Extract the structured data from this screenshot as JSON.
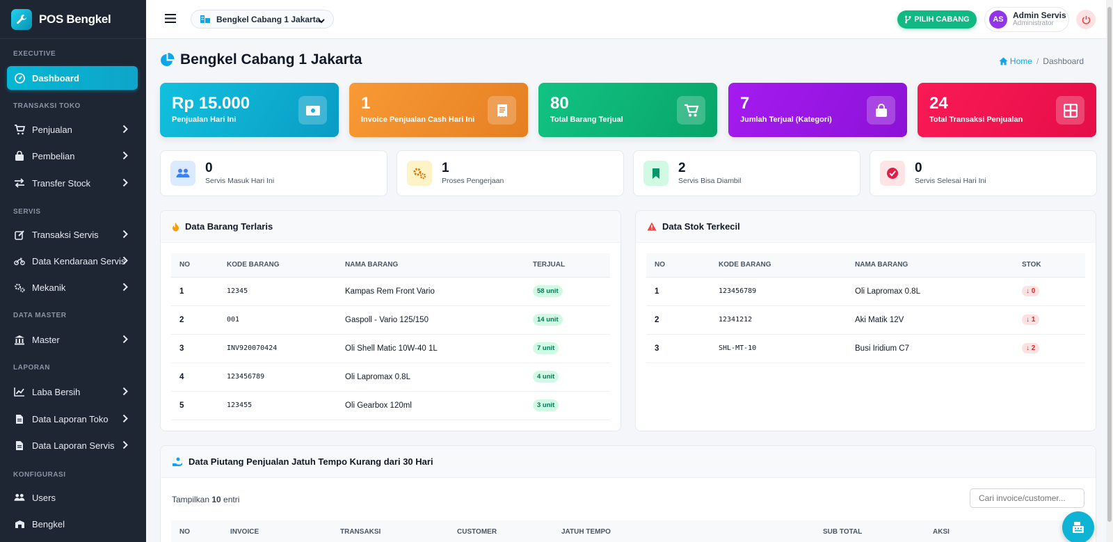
{
  "app": {
    "name": "POS Bengkel"
  },
  "sidebar": {
    "sections": [
      "EXECUTIVE",
      "TRANSAKSI TOKO",
      "SERVIS",
      "DATA MASTER",
      "LAPORAN",
      "KONFIGURASI"
    ],
    "items": [
      {
        "label": "Dashboard",
        "icon": "dashboard-icon"
      },
      {
        "label": "Penjualan",
        "icon": "cart-icon"
      },
      {
        "label": "Pembelian",
        "icon": "bag-icon"
      },
      {
        "label": "Transfer Stock",
        "icon": "transfer-icon"
      },
      {
        "label": "Transaksi Servis",
        "icon": "edit-icon"
      },
      {
        "label": "Data Kendaraan Servis",
        "icon": "motorcycle-icon"
      },
      {
        "label": "Mekanik",
        "icon": "gears-icon"
      },
      {
        "label": "Master",
        "icon": "bank-icon"
      },
      {
        "label": "Laba Bersih",
        "icon": "chart-line-icon"
      },
      {
        "label": "Data Laporan Toko",
        "icon": "file-icon"
      },
      {
        "label": "Data Laporan Servis",
        "icon": "file-icon"
      },
      {
        "label": "Users",
        "icon": "users-icon"
      },
      {
        "label": "Bengkel",
        "icon": "building-icon"
      }
    ]
  },
  "topbar": {
    "branch": "Bengkel Cabang 1 Jakarta",
    "pilih_cabang": "PILIH CABANG",
    "user_initials": "AS",
    "user_name": "Admin Servis",
    "user_role": "Administrator"
  },
  "page": {
    "title": "Bengkel Cabang 1 Jakarta",
    "breadcrumb_home": "Home",
    "breadcrumb_sep": "/",
    "breadcrumb_current": "Dashboard"
  },
  "stats": [
    {
      "value": "Rp 15.000",
      "label": "Penjualan Hari Ini",
      "color": "#0fb3d6",
      "icon": "money-icon"
    },
    {
      "value": "1",
      "label": "Invoice Penjualan Cash Hari Ini",
      "color": "#f3902f",
      "icon": "receipt-icon"
    },
    {
      "value": "80",
      "label": "Total Barang Terjual",
      "color": "#10b577",
      "icon": "cart-icon"
    },
    {
      "value": "7",
      "label": "Jumlah Terjual (Kategori)",
      "color": "#9b16e8",
      "icon": "shopping-bag-icon"
    },
    {
      "value": "24",
      "label": "Total Transaksi Penjualan",
      "color": "#f2134f",
      "icon": "grid-icon"
    }
  ],
  "service_stats": [
    {
      "value": "0",
      "label": "Servis Masuk Hari Ini",
      "icon": "users-icon",
      "color": "#3b82f6",
      "bg": "#dbeafe"
    },
    {
      "value": "1",
      "label": "Proses Pengerjaan",
      "icon": "gears-icon",
      "color": "#d97706",
      "bg": "#fef3c7"
    },
    {
      "value": "2",
      "label": "Servis Bisa Diambil",
      "icon": "bookmark-icon",
      "color": "#059669",
      "bg": "#d1fae5"
    },
    {
      "value": "0",
      "label": "Servis Selesai Hari Ini",
      "icon": "check-circle-icon",
      "color": "#e11d48",
      "bg": "#ffe4e6"
    }
  ],
  "terlaris": {
    "title": "Data Barang Terlaris",
    "headers": [
      "NO",
      "KODE BARANG",
      "NAMA BARANG",
      "TERJUAL"
    ],
    "rows": [
      [
        "1",
        "12345",
        "Kampas Rem Front Vario",
        "58 unit"
      ],
      [
        "2",
        "001",
        "Gaspoll - Vario 125/150",
        "14 unit"
      ],
      [
        "3",
        "INV920070424",
        "Oli Shell Matic 10W-40 1L",
        "7 unit"
      ],
      [
        "4",
        "123456789",
        "Oli Lapromax 0.8L",
        "4 unit"
      ],
      [
        "5",
        "123455",
        "Oli Gearbox 120ml",
        "3 unit"
      ]
    ]
  },
  "stok": {
    "title": "Data Stok Terkecil",
    "headers": [
      "NO",
      "KODE BARANG",
      "NAMA BARANG",
      "STOK"
    ],
    "rows": [
      [
        "1",
        "123456789",
        "Oli Lapromax 0.8L",
        "0"
      ],
      [
        "2",
        "12341212",
        "Aki Matik 12V",
        "1"
      ],
      [
        "3",
        "SHL-MT-10",
        "Busi Iridium C7",
        "2"
      ]
    ]
  },
  "piutang": {
    "title": "Data Piutang Penjualan Jatuh Tempo Kurang dari 30 Hari",
    "show_prefix": "Tampilkan ",
    "show_count": "10",
    "show_suffix": " entri",
    "search_placeholder": "Cari invoice/customer...",
    "headers": [
      "NO",
      "INVOICE",
      "TRANSAKSI",
      "CUSTOMER",
      "JATUH TEMPO",
      "SUB TOTAL",
      "AKSI"
    ]
  }
}
